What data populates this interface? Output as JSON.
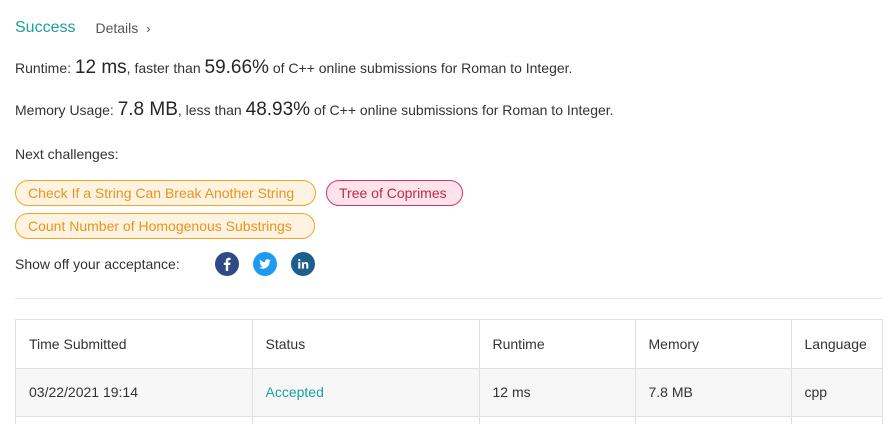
{
  "header": {
    "title": "Success",
    "details_label": "Details",
    "details_chevron": "›"
  },
  "runtime": {
    "label": "Runtime:",
    "value": "12 ms",
    "comparison": ", faster than",
    "percent": "59.66%",
    "suffix": "of C++ online submissions for Roman to Integer."
  },
  "memory": {
    "label": "Memory Usage:",
    "value": "7.8 MB",
    "comparison": ", less than",
    "percent": "48.93%",
    "suffix": "of C++ online submissions for Roman to Integer."
  },
  "next_challenges": {
    "label": "Next challenges:",
    "items": [
      {
        "label": "Check If a String Can Break Another String",
        "difficulty": "medium"
      },
      {
        "label": "Tree of Coprimes",
        "difficulty": "hard"
      },
      {
        "label": "Count Number of Homogenous Substrings",
        "difficulty": "medium"
      }
    ]
  },
  "share": {
    "label": "Show off your acceptance:",
    "icons": [
      "facebook-icon",
      "twitter-icon",
      "linkedin-icon"
    ]
  },
  "colors": {
    "success": "#1ba29a",
    "medium": "#f5a623",
    "hard": "#d1356a",
    "facebook": "#2f4a86",
    "twitter": "#1d9bf0",
    "linkedin": "#1b5f8c"
  },
  "submissions": {
    "columns": [
      "Time Submitted",
      "Status",
      "Runtime",
      "Memory",
      "Language"
    ],
    "rows": [
      {
        "time": "03/22/2021 19:14",
        "status": "Accepted",
        "runtime": "12 ms",
        "memory": "7.8 MB",
        "language": "cpp"
      }
    ]
  }
}
